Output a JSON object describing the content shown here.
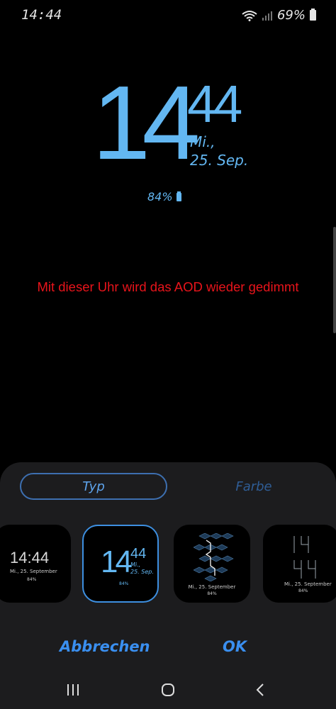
{
  "status_bar": {
    "time": "14:44",
    "battery": "69%"
  },
  "clock": {
    "hour": "14",
    "minute": "44",
    "day": "Mi.,",
    "date": "25. Sep."
  },
  "aod_battery": "84%",
  "notice": "Mit dieser Uhr wird das AOD wieder gedimmt",
  "tabs": {
    "type": "Typ",
    "color": "Farbe"
  },
  "thumbnails": [
    {
      "time": "14:44",
      "date": "Mi., 25. September",
      "battery": "84%"
    },
    {
      "hour": "14",
      "minute": "44",
      "day": "Mi.,",
      "date": "25. Sep.",
      "battery": "84%"
    },
    {
      "date": "Mi., 25. September",
      "battery": "84%"
    },
    {
      "date": "Mi., 25. September",
      "battery": "84%"
    }
  ],
  "actions": {
    "cancel": "Abbrechen",
    "ok": "OK"
  },
  "colors": {
    "accent": "#63b7f2",
    "notice": "#e8141b",
    "button": "#3a8ff0"
  }
}
